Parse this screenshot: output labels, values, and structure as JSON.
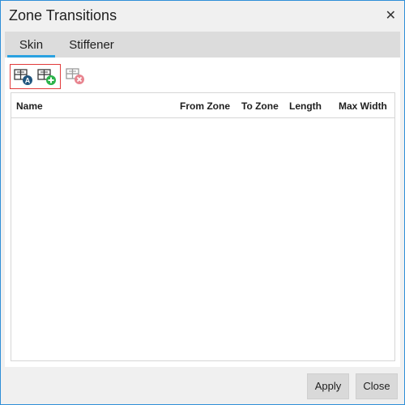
{
  "window": {
    "title": "Zone Transitions",
    "close_glyph": "✕"
  },
  "tabs": [
    {
      "label": "Skin",
      "active": true
    },
    {
      "label": "Stiffener",
      "active": false
    }
  ],
  "toolbar": {
    "items": [
      {
        "icon": "add-zone-transition-a-icon"
      },
      {
        "icon": "add-zone-transition-plus-icon"
      },
      {
        "icon": "delete-zone-transition-icon"
      }
    ]
  },
  "table": {
    "columns": [
      "Name",
      "From Zone",
      "To Zone",
      "Length",
      "Max Width"
    ],
    "rows": []
  },
  "footer": {
    "apply_label": "Apply",
    "close_label": "Close"
  }
}
